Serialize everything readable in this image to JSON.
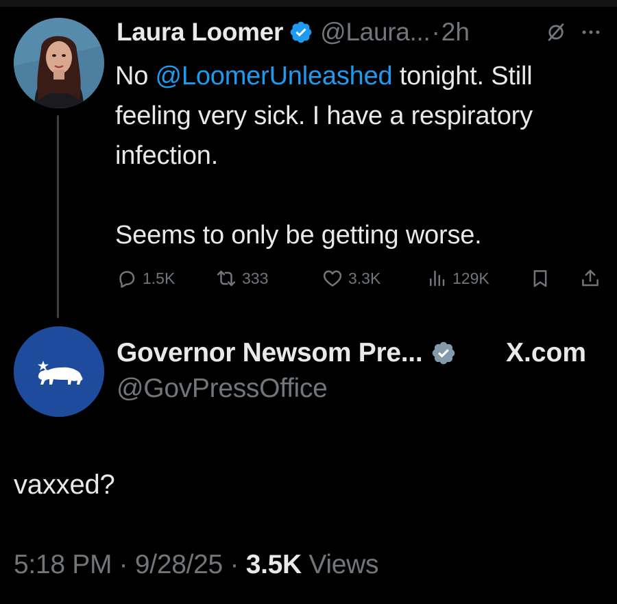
{
  "colors": {
    "background": "#000000",
    "text": "#e7e9ea",
    "muted": "#71767b",
    "link": "#1d9bf0",
    "verified_blue": "#1d9bf0",
    "verified_gray": "#829aab",
    "gov_avatar_blue": "#1f4b9c"
  },
  "original_tweet": {
    "author_name": "Laura Loomer",
    "handle": "@Laura...",
    "separator": "·",
    "time": "2h",
    "verified_icon": "verified-badge-blue-icon",
    "text_before_mention": "No ",
    "mention": "@LoomerUnleashed",
    "text_line1_rest": " tonight. Still feeling very sick. I have a respiratory infection.",
    "text_line2": "Seems to only be getting worse.",
    "actions": {
      "replies": "1.5K",
      "reposts": "333",
      "likes": "3.3K",
      "views": "129K"
    }
  },
  "reply_tweet": {
    "author_name": "Governor Newsom Pre...",
    "handle": "@GovPressOffice",
    "verified_icon": "verified-badge-gray-icon",
    "source_label": "X.com",
    "text": "vaxxed?",
    "meta_time": "5:18 PM · 9/28/25 · ",
    "meta_views_count": "3.5K",
    "meta_views_label": " Views"
  }
}
